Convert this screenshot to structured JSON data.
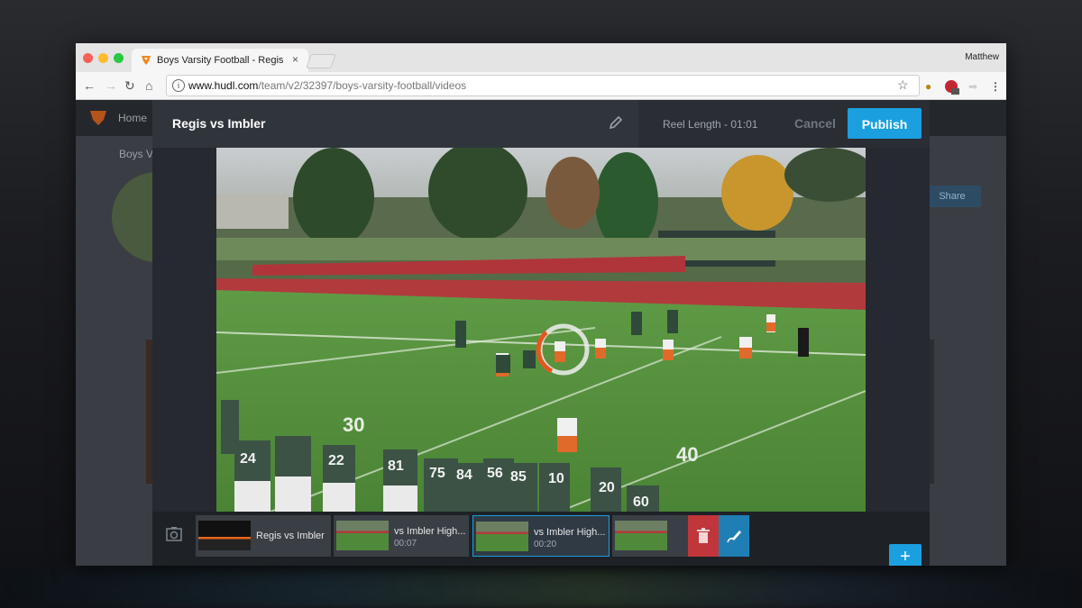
{
  "browser": {
    "tab_title": "Boys Varsity Football - Regis",
    "tab_close": "×",
    "profile_name": "Matthew",
    "url_host": "www.hudl.com",
    "url_path": "/team/v2/32397/boys-varsity-football/videos",
    "ext_badge": "1"
  },
  "site": {
    "nav_home": "Home",
    "team_name": "Boys V",
    "share_label": "Share"
  },
  "editor": {
    "title": "Regis vs Imbler",
    "reel_length": "Reel Length - 01:01",
    "cancel_label": "Cancel",
    "publish_label": "Publish",
    "add_label": "+"
  },
  "timeline": {
    "clips": [
      {
        "label": "Regis vs Imbler",
        "duration": ""
      },
      {
        "label": "vs Imbler High...",
        "duration": "00:07"
      },
      {
        "label": "vs Imbler High...",
        "duration": "00:20"
      },
      {
        "label": "",
        "duration": ""
      }
    ]
  },
  "video": {
    "yard_numbers": [
      "30",
      "40"
    ],
    "jersey_numbers": [
      "24",
      "22",
      "81",
      "75",
      "84",
      "56",
      "85",
      "10",
      "20",
      "60"
    ]
  },
  "colors": {
    "accent": "#1b9fdf",
    "delete": "#c0363b",
    "field": "#4f8a3a",
    "track": "#b0353a"
  },
  "icons": [
    "pencil-icon",
    "camera-icon",
    "trash-icon",
    "draw-icon",
    "hudl-logo-icon",
    "star-icon",
    "info-icon"
  ]
}
